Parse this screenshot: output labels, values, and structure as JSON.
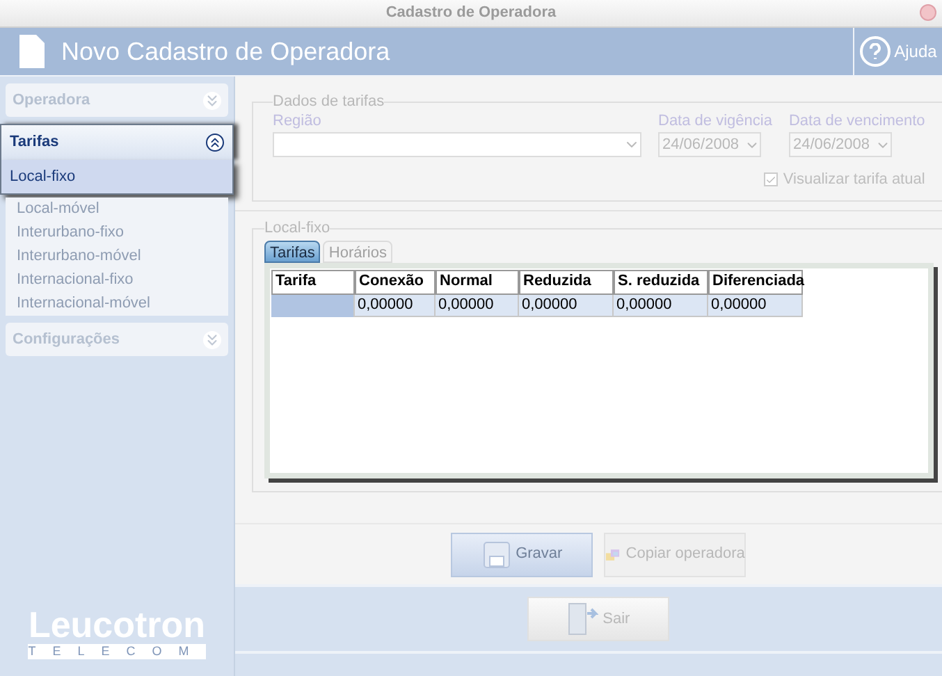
{
  "window": {
    "title": "Cadastro de Operadora"
  },
  "header": {
    "title": "Novo Cadastro de Operadora",
    "help_label": "Ajuda"
  },
  "sidebar": {
    "sections": [
      {
        "title": "Operadora",
        "expanded": false
      },
      {
        "title": "Tarifas",
        "expanded": true,
        "items": [
          {
            "label": "Local-fixo",
            "selected": true
          },
          {
            "label": "Local-móvel",
            "selected": false
          },
          {
            "label": "Interurbano-fixo",
            "selected": false
          },
          {
            "label": "Interurbano-móvel",
            "selected": false
          },
          {
            "label": "Internacional-fixo",
            "selected": false
          },
          {
            "label": "Internacional-móvel",
            "selected": false
          }
        ]
      },
      {
        "title": "Configurações",
        "expanded": false
      }
    ],
    "logo": {
      "name": "Leucotron",
      "tagline": "TELECOM"
    }
  },
  "rates_group": {
    "legend": "Dados de tarifas",
    "region_label": "Região",
    "dates": [
      {
        "label": "Data de vigência",
        "value": "24/06/2008"
      },
      {
        "label": "Data de vencimento",
        "value": "24/06/2008"
      }
    ],
    "show_current": {
      "label": "Visualizar tarifa atual",
      "checked": true
    }
  },
  "local_group": {
    "legend": "Local-fixo",
    "tabs": [
      {
        "label": "Tarifas",
        "selected": true
      },
      {
        "label": "Horários",
        "selected": false
      }
    ],
    "table": {
      "columns": [
        "Tarifa",
        "Conexão",
        "Normal",
        "Reduzida",
        "S. reduzida",
        "Diferenciada"
      ],
      "rows": [
        {
          "selected": true,
          "values": [
            "0,00000",
            "0,00000",
            "0,00000",
            "0,00000",
            "0,00000"
          ]
        }
      ]
    }
  },
  "buttons": [
    {
      "label": "Gravar",
      "kind": "primary"
    },
    {
      "label": "Copiar operadora",
      "kind": "normal"
    }
  ],
  "exit_button": {
    "label": "Sair"
  }
}
